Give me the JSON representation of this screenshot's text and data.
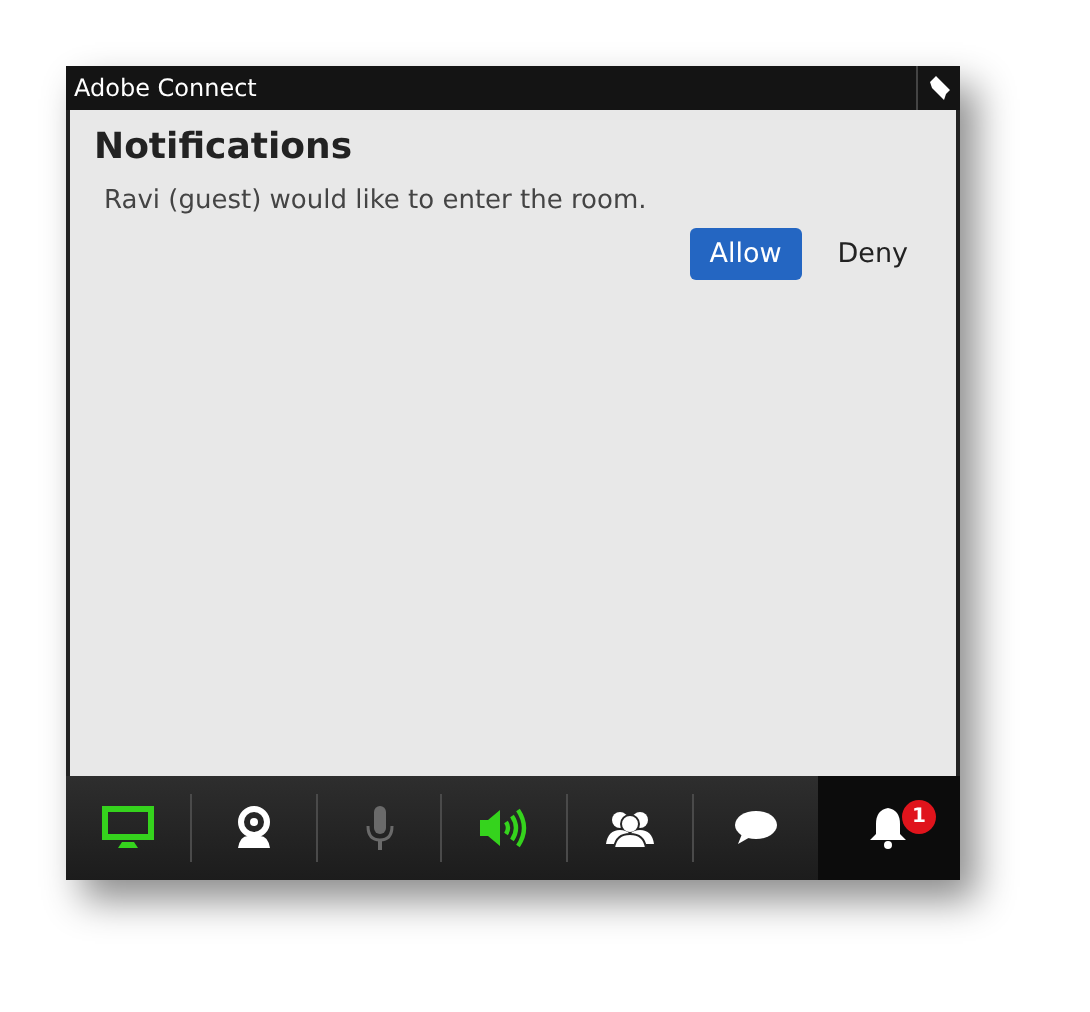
{
  "window": {
    "title": "Adobe Connect"
  },
  "panel": {
    "title": "Notifications",
    "message": "Ravi (guest) would like to enter the room.",
    "buttons": [
      {
        "label": "Allow",
        "primary": true
      },
      {
        "label": "Deny",
        "primary": false
      }
    ]
  },
  "toolbar": [
    {
      "kind": "screen",
      "on": true,
      "disabled": false,
      "selected": false
    },
    {
      "kind": "camera",
      "on": false,
      "disabled": false,
      "selected": false
    },
    {
      "kind": "microphone",
      "on": false,
      "disabled": true,
      "selected": false
    },
    {
      "kind": "speaker",
      "on": true,
      "disabled": false,
      "selected": false
    },
    {
      "kind": "attendees",
      "on": false,
      "disabled": false,
      "selected": false
    },
    {
      "kind": "chat",
      "on": false,
      "disabled": false,
      "selected": false
    },
    {
      "kind": "notifications",
      "on": false,
      "disabled": false,
      "selected": true,
      "badge": "1"
    }
  ]
}
